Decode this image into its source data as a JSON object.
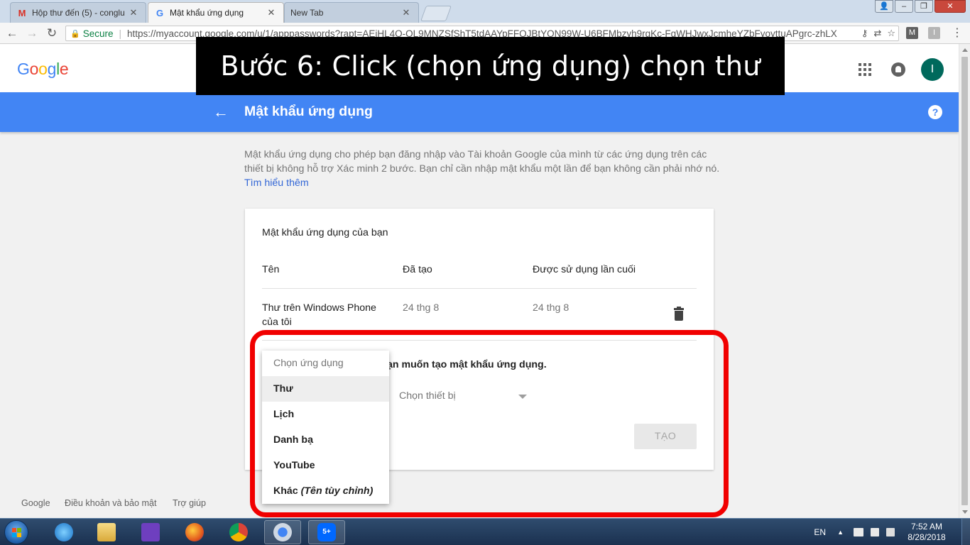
{
  "browser": {
    "tabs": [
      {
        "title": "Hộp thư đến (5) - conglu",
        "favicon": "gmail-icon"
      },
      {
        "title": "Mật khẩu ứng dụng",
        "favicon": "google-icon"
      },
      {
        "title": "New Tab",
        "favicon": ""
      }
    ],
    "secure_label": "Secure",
    "url": "https://myaccount.google.com/u/1/apppasswords?rapt=AEjHL4O-OL9MNZSfShT5tdAAYpFFOJBtYON99W-U6BFMbzyh9rgKc-FgWHJwxJcmheYZbFyoyttuAPgrc-zhLX",
    "extensions": [
      "M",
      "I"
    ]
  },
  "annotation": {
    "banner_text": "Bước 6: Click (chọn ứng dụng) chọn thư",
    "highlight_color": "#f10000"
  },
  "header": {
    "logo": "Google",
    "avatar_letter": "I"
  },
  "bluebar": {
    "title": "Mật khẩu ứng dụng",
    "color": "#4285f4"
  },
  "intro": {
    "text": "Mật khẩu ứng dụng cho phép bạn đăng nhập vào Tài khoản Google của mình từ các ứng dụng trên các thiết bị không hỗ trợ Xác minh 2 bước. Bạn chỉ cần nhập mật khẩu một lần để bạn không cần phải nhớ nó. ",
    "link": "Tìm hiểu thêm"
  },
  "card": {
    "title": "Mật khẩu ứng dụng của bạn",
    "columns": [
      "Tên",
      "Đã tạo",
      "Được sử dụng lần cuối"
    ],
    "rows": [
      {
        "name": "Thư trên Windows Phone của tôi",
        "created": "24 thg 8",
        "last_used": "24 thg 8"
      }
    ],
    "generate_label": "ạn muốn tạo mật khẩu ứng dụng.",
    "device_placeholder": "Chọn thiết bị",
    "create_button": "TẠO"
  },
  "dropdown": {
    "header": "Chọn ứng dụng",
    "options": [
      "Thư",
      "Lịch",
      "Danh bạ",
      "YouTube"
    ],
    "other_label": "Khác",
    "other_hint": "(Tên tùy chỉnh)",
    "selected": "Thư"
  },
  "footer": [
    "Google",
    "Điều khoản và bảo mật",
    "Trợ giúp"
  ],
  "taskbar": {
    "language": "EN",
    "time": "7:52 AM",
    "date": "8/28/2018",
    "zalo_badge": "5+"
  }
}
